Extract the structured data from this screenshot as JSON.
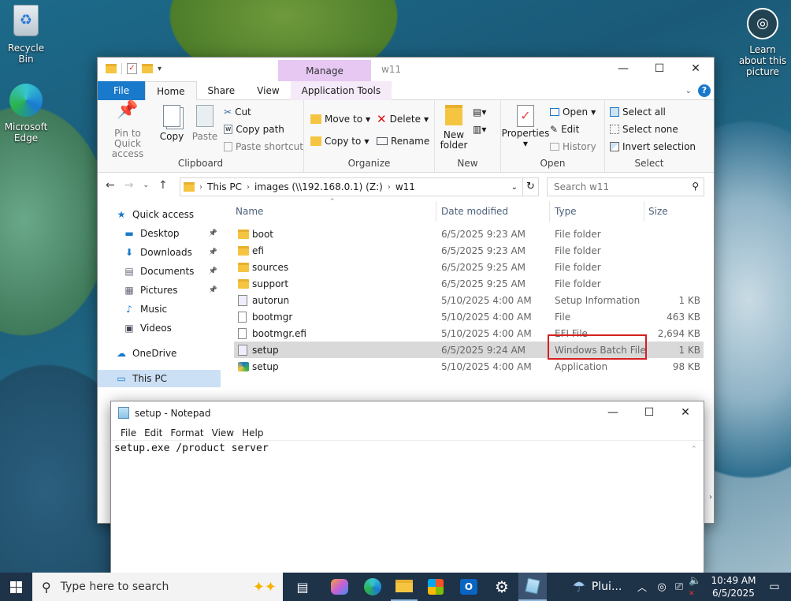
{
  "desktop": {
    "recycle_bin": "Recycle Bin",
    "edge": "Microsoft Edge",
    "learn": "Learn about this picture"
  },
  "explorer": {
    "title": "w11",
    "manage_tab": "Manage",
    "tabs": [
      "File",
      "Home",
      "Share",
      "View",
      "Application Tools"
    ],
    "ribbon": {
      "clipboard": {
        "pin": "Pin to Quick access",
        "copy": "Copy",
        "paste": "Paste",
        "cut": "Cut",
        "copy_path": "Copy path",
        "paste_shortcut": "Paste shortcut",
        "label": "Clipboard"
      },
      "organize": {
        "move_to": "Move to",
        "copy_to": "Copy to",
        "delete": "Delete",
        "rename": "Rename",
        "label": "Organize"
      },
      "new": {
        "new_folder": "New folder",
        "label": "New"
      },
      "open": {
        "properties": "Properties",
        "open": "Open",
        "edit": "Edit",
        "history": "History",
        "label": "Open"
      },
      "select": {
        "select_all": "Select all",
        "select_none": "Select none",
        "invert": "Invert selection",
        "label": "Select"
      }
    },
    "address": {
      "crumbs": [
        "This PC",
        "images (\\\\192.168.0.1) (Z:)",
        "w11"
      ],
      "search_placeholder": "Search w11"
    },
    "sidebar": [
      {
        "label": "Quick access",
        "pinned": false
      },
      {
        "label": "Desktop",
        "pinned": true
      },
      {
        "label": "Downloads",
        "pinned": true
      },
      {
        "label": "Documents",
        "pinned": true
      },
      {
        "label": "Pictures",
        "pinned": true
      },
      {
        "label": "Music",
        "pinned": false
      },
      {
        "label": "Videos",
        "pinned": false
      },
      {
        "label": "OneDrive",
        "pinned": false
      },
      {
        "label": "This PC",
        "pinned": false
      }
    ],
    "columns": [
      "Name",
      "Date modified",
      "Type",
      "Size"
    ],
    "files": [
      {
        "name": "boot",
        "date": "6/5/2025 9:23 AM",
        "type": "File folder",
        "size": "",
        "kind": "folder"
      },
      {
        "name": "efi",
        "date": "6/5/2025 9:23 AM",
        "type": "File folder",
        "size": "",
        "kind": "folder"
      },
      {
        "name": "sources",
        "date": "6/5/2025 9:25 AM",
        "type": "File folder",
        "size": "",
        "kind": "folder"
      },
      {
        "name": "support",
        "date": "6/5/2025 9:25 AM",
        "type": "File folder",
        "size": "",
        "kind": "folder"
      },
      {
        "name": "autorun",
        "date": "5/10/2025 4:00 AM",
        "type": "Setup Information",
        "size": "1 KB",
        "kind": "inf"
      },
      {
        "name": "bootmgr",
        "date": "5/10/2025 4:00 AM",
        "type": "File",
        "size": "463 KB",
        "kind": "file"
      },
      {
        "name": "bootmgr.efi",
        "date": "5/10/2025 4:00 AM",
        "type": "EFI File",
        "size": "2,694 KB",
        "kind": "file"
      },
      {
        "name": "setup",
        "date": "6/5/2025 9:24 AM",
        "type": "Windows Batch File",
        "size": "1 KB",
        "kind": "bat"
      },
      {
        "name": "setup",
        "date": "5/10/2025 4:00 AM",
        "type": "Application",
        "size": "98 KB",
        "kind": "exe"
      }
    ]
  },
  "notepad": {
    "title": "setup - Notepad",
    "menu": [
      "File",
      "Edit",
      "Format",
      "View",
      "Help"
    ],
    "content": "setup.exe /product server"
  },
  "taskbar": {
    "search_placeholder": "Type here to search",
    "weather": "Plui...",
    "time": "10:49 AM",
    "date": "6/5/2025"
  },
  "colors": {
    "accent": "#1979ca",
    "highlight": "#d61f1f",
    "manage_tab": "#e6c8f2"
  }
}
